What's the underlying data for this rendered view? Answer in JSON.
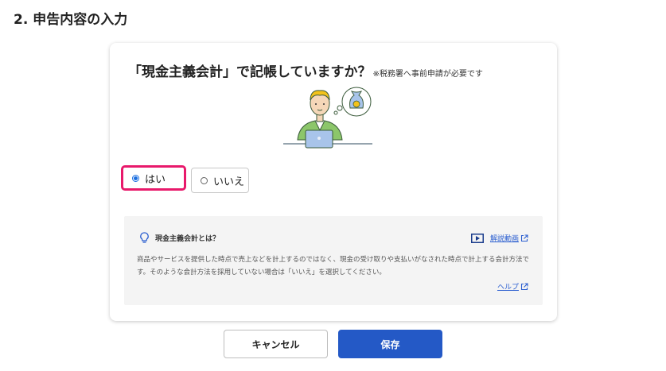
{
  "section": {
    "title": "2. 申告内容の入力"
  },
  "question": {
    "main": "「現金主義会計」で記帳していますか？",
    "note": "※税務署へ事前申請が必要です"
  },
  "options": [
    {
      "label": "はい",
      "selected": true
    },
    {
      "label": "いいえ",
      "selected": false
    }
  ],
  "info": {
    "title": "現金主義会計とは？",
    "video_link": "解説動画",
    "body": "商品やサービスを提供した時点で売上などを計上するのではなく、現金の受け取りや支払いがなされた時点で計上する会計方法です。そのような会計方法を採用していない場合は「いいえ」を選択してください。",
    "help_link": "ヘルプ"
  },
  "buttons": {
    "cancel": "キャンセル",
    "save": "保存"
  },
  "colors": {
    "accent": "#2459c6",
    "highlight": "#e8196b",
    "illustration_green": "#8cc66a"
  },
  "icons": [
    "lightbulb-icon",
    "video-play-icon",
    "external-link-icon",
    "money-bag-icon"
  ]
}
